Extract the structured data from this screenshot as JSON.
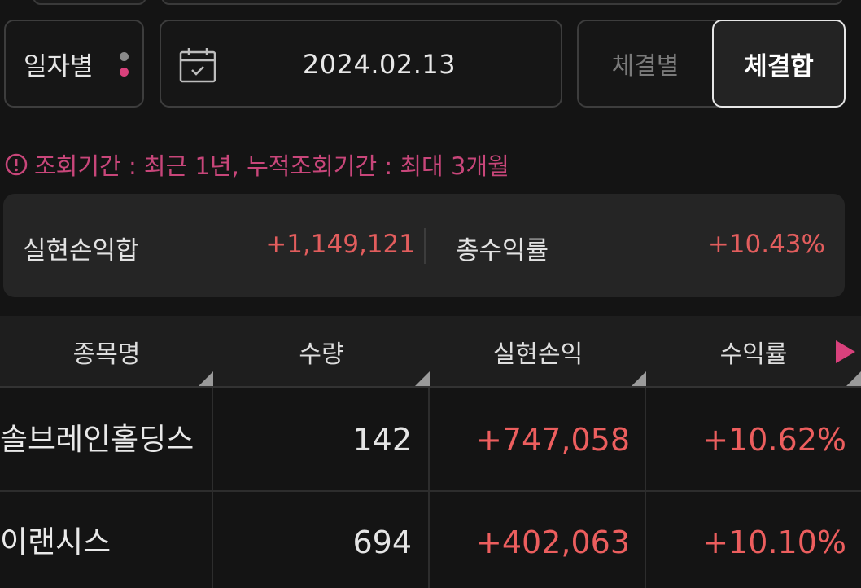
{
  "filters": {
    "period_label": "일자별",
    "date_value": "2024.02.13",
    "segment_option_1": "체결별",
    "segment_option_2": "체결합"
  },
  "notice": {
    "text": "조회기간 : 최근 1년, 누적조회기간 : 최대 3개월"
  },
  "summary": {
    "realized_pnl_label": "실현손익합",
    "realized_pnl_value": "+1,149,121",
    "total_return_label": "총수익률",
    "total_return_value": "+10.43%"
  },
  "table": {
    "headers": [
      "종목명",
      "수량",
      "실현손익",
      "수익률"
    ],
    "rows": [
      {
        "name": "솔브레인홀딩스",
        "qty": "142",
        "pnl": "+747,058",
        "rate": "+10.62%"
      },
      {
        "name": "이랜시스",
        "qty": "694",
        "pnl": "+402,063",
        "rate": "+10.10%"
      }
    ]
  },
  "colors": {
    "accent_pink": "#d9417c",
    "profit_red": "#ec5e5e",
    "background": "#141414"
  },
  "icons": [
    "kebab-menu-icon",
    "calendar-icon",
    "info-circle-icon",
    "play-right-icon"
  ]
}
